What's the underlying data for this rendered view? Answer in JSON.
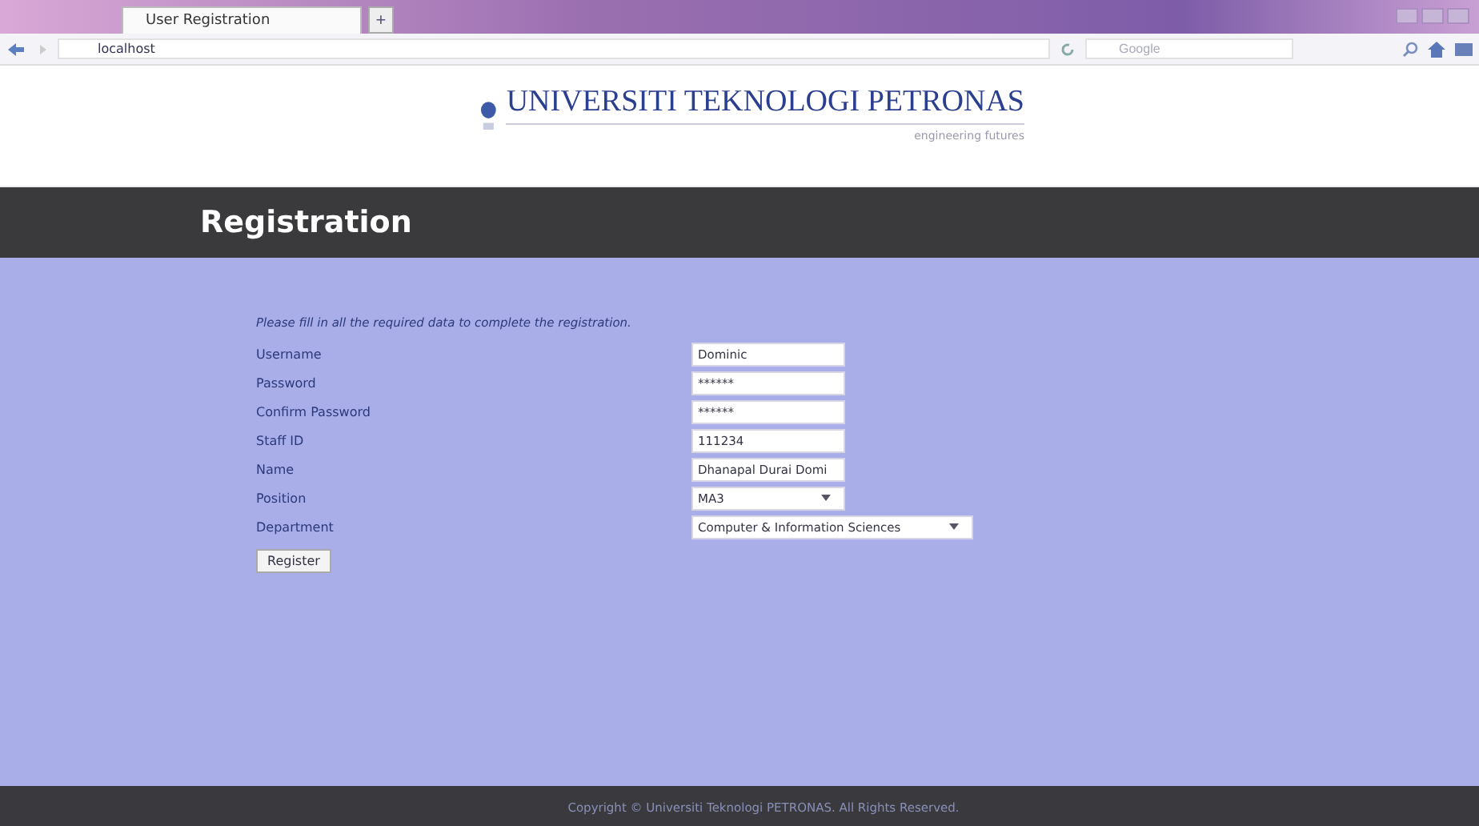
{
  "browser": {
    "tab": {
      "title": "User Registration",
      "selected": true
    },
    "new_tab": "+",
    "address": "localhost",
    "search_placeholder": "Google"
  },
  "header": {
    "org": "UNIVERSITI TEKNOLOGI PETRONAS",
    "tagline": "engineering futures"
  },
  "page_title": "Registration",
  "form": {
    "instruction": "Please fill in all the required data to complete the registration.",
    "fields": [
      {
        "label": "Username",
        "kind": "text",
        "value": "Dominic"
      },
      {
        "label": "Password",
        "kind": "password",
        "value": "******"
      },
      {
        "label": "Confirm Password",
        "kind": "password",
        "value": "******"
      },
      {
        "label": "Staff ID",
        "kind": "text",
        "value": "111234"
      },
      {
        "label": "Name",
        "kind": "text",
        "value": "Dhanapal Durai Domi"
      },
      {
        "label": "Position",
        "kind": "select",
        "value": "MA3"
      },
      {
        "label": "Department",
        "kind": "select-wide",
        "value": "Computer & Information Sciences"
      }
    ],
    "submit": "Register"
  },
  "footer": "Copyright © Universiti Teknologi PETRONAS. All Rights Reserved."
}
